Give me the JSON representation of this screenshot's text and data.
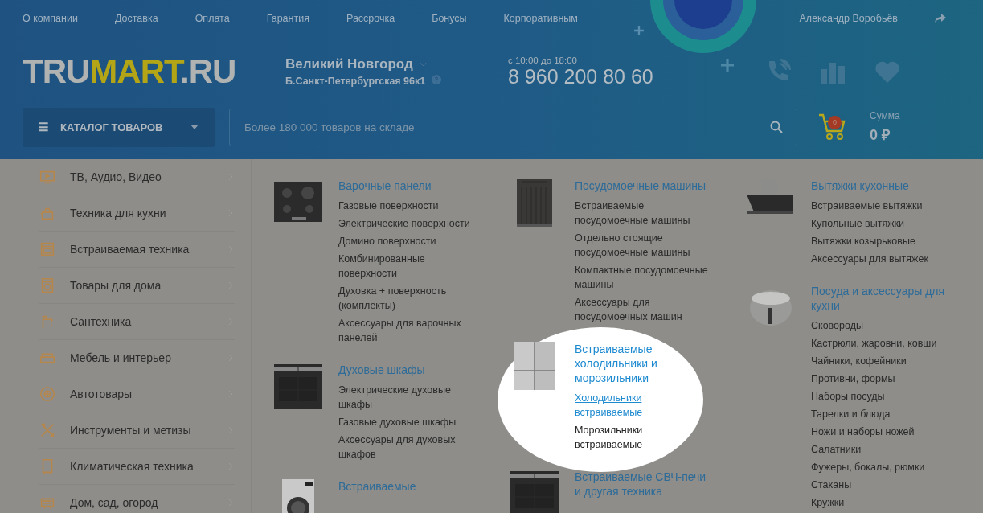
{
  "top_nav": {
    "links": [
      "О компании",
      "Доставка",
      "Оплата",
      "Гарантия",
      "Рассрочка",
      "Бонусы",
      "Корпоративным"
    ],
    "user": "Александр Воробьёв"
  },
  "logo": [
    {
      "text": "TRU",
      "highlight": false
    },
    {
      "text": "MART",
      "highlight": true
    },
    {
      "text": ".RU",
      "highlight": false
    }
  ],
  "location": {
    "city": "Великий Новгород",
    "address": "Б.Санкт-Петербургская 96к1"
  },
  "contact": {
    "hours": "с 10:00 до 18:00",
    "phone": "8 960 200 80 60"
  },
  "catalog_button": {
    "icon": "☰",
    "label": "КАТАЛОГ ТОВАРОВ"
  },
  "search": {
    "placeholder": "Более 180 000 товаров на складе"
  },
  "cart": {
    "count": "0",
    "sum_label": "Сумма",
    "sum": "0 ₽"
  },
  "sidebar": {
    "items": [
      "ТВ, Аудио, Видео",
      "Техника для кухни",
      "Встраиваемая техника",
      "Товары для дома",
      "Сантехника",
      "Мебель и интерьер",
      "Автотовары",
      "Инструменты и метизы",
      "Климатическая техника",
      "Дом, сад, огород"
    ]
  },
  "columns": [
    {
      "groups": [
        {
          "title": "Варочные панели",
          "highlighted": false,
          "items": [
            {
              "label": "Газовые поверхности",
              "hovered": false
            },
            {
              "label": "Электрические поверхности",
              "hovered": false
            },
            {
              "label": "Домино поверхности",
              "hovered": false
            },
            {
              "label": "Комбинированные поверхности",
              "hovered": false
            },
            {
              "label": "Духовка + поверхность (комплекты)",
              "hovered": false
            },
            {
              "label": "Аксессуары для варочных панелей",
              "hovered": false
            }
          ]
        },
        {
          "title": "Духовые шкафы",
          "highlighted": false,
          "items": [
            {
              "label": "Электрические духовые шкафы",
              "hovered": false
            },
            {
              "label": "Газовые духовые шкафы",
              "hovered": false
            },
            {
              "label": "Аксессуары для духовых шкафов",
              "hovered": false
            }
          ]
        },
        {
          "title": "Встраиваемые",
          "highlighted": false
        }
      ]
    },
    {
      "groups": [
        {
          "title": "Посудомоечные машины",
          "highlighted": false,
          "items": [
            {
              "label": "Встраиваемые посудомоечные машины",
              "hovered": false
            },
            {
              "label": "Отдельно стоящие посудомоечные машины",
              "hovered": false
            },
            {
              "label": "Компактные посудомоечные машины",
              "hovered": false
            },
            {
              "label": "Аксессуары для посудомоечных машин",
              "hovered": false
            }
          ]
        },
        {
          "title": "Встраиваемые холодильники и морозильники",
          "highlighted": true,
          "items": [
            {
              "label": "Холодильники встраиваемые",
              "hovered": true
            },
            {
              "label": "Морозильники встраиваемые",
              "hovered": false
            }
          ]
        },
        {
          "title": "Встраиваемые СВЧ-печи и другая техника",
          "highlighted": false
        }
      ]
    },
    {
      "groups": [
        {
          "title": "Вытяжки кухонные",
          "highlighted": false,
          "items": [
            {
              "label": "Встраиваемые вытяжки",
              "hovered": false
            },
            {
              "label": "Купольные вытяжки",
              "hovered": false
            },
            {
              "label": "Вытяжки козырьковые",
              "hovered": false
            },
            {
              "label": "Аксессуары для вытяжек",
              "hovered": false
            }
          ]
        },
        {
          "title": "Посуда и аксессуары для кухни",
          "highlighted": false,
          "items": [
            {
              "label": "Сковороды",
              "hovered": false
            },
            {
              "label": "Кастрюли, жаровни, ковши",
              "hovered": false
            },
            {
              "label": "Чайники, кофейники",
              "hovered": false
            },
            {
              "label": "Противни, формы",
              "hovered": false
            },
            {
              "label": "Наборы посуды",
              "hovered": false
            },
            {
              "label": "Тарелки и блюда",
              "hovered": false
            },
            {
              "label": "Ножи и наборы ножей",
              "hovered": false
            },
            {
              "label": "Салатники",
              "hovered": false
            },
            {
              "label": "Фужеры, бокалы, рюмки",
              "hovered": false
            },
            {
              "label": "Стаканы",
              "hovered": false
            },
            {
              "label": "Кружки",
              "hovered": false
            }
          ]
        }
      ]
    }
  ]
}
